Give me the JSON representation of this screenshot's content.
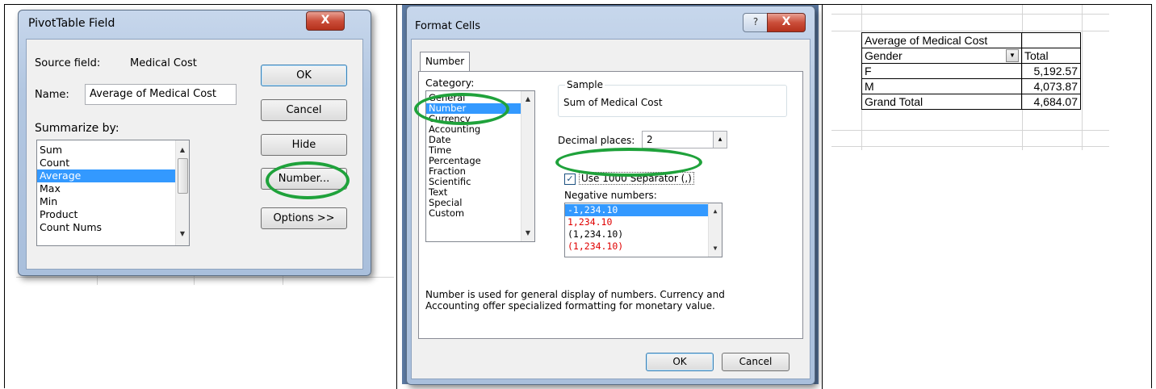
{
  "left_dialog": {
    "title": "PivotTable Field",
    "close_label": "X",
    "source_field_label": "Source field:",
    "source_field_value": "Medical Cost",
    "name_label": "Name:",
    "name_value": "Average of Medical Cost",
    "summarize_label": "Summarize by:",
    "summarize_items": [
      "Sum",
      "Count",
      "Average",
      "Max",
      "Min",
      "Product",
      "Count Nums"
    ],
    "selected_item": "Average",
    "ok_label": "OK",
    "cancel_label": "Cancel",
    "hide_label": "Hide",
    "number_label": "Number...",
    "options_label": "Options >>"
  },
  "format_dialog": {
    "title": "Format Cells",
    "help_label": "?",
    "close_label": "X",
    "tab_label": "Number",
    "category_label": "Category:",
    "categories": [
      "General",
      "Number",
      "Currency",
      "Accounting",
      "Date",
      "Time",
      "Percentage",
      "Fraction",
      "Scientific",
      "Text",
      "Special",
      "Custom"
    ],
    "selected_category": "Number",
    "sample_label": "Sample",
    "sample_value": "Sum of Medical Cost",
    "decimal_label": "Decimal places:",
    "decimal_value": "2",
    "separator_label": "Use 1000 Separator (,)",
    "separator_checked": true,
    "negative_label": "Negative numbers:",
    "negative_items": [
      {
        "text": "-1,234.10",
        "color": "#000000",
        "selected": true
      },
      {
        "text": "1,234.10",
        "color": "#e00000",
        "selected": false
      },
      {
        "text": "(1,234.10)",
        "color": "#000000",
        "selected": false
      },
      {
        "text": "(1,234.10)",
        "color": "#e00000",
        "selected": false
      }
    ],
    "description": "Number is used for general display of numbers.  Currency and Accounting offer specialized formatting for monetary value.",
    "ok_label": "OK",
    "cancel_label": "Cancel"
  },
  "pivot_table": {
    "header": "Average of Medical Cost",
    "row_label": "Gender",
    "col_label": "Total",
    "rows": [
      {
        "label": "F",
        "value": "5,192.57"
      },
      {
        "label": "M",
        "value": "4,073.87"
      },
      {
        "label": "Grand Total",
        "value": "4,684.07"
      }
    ]
  },
  "colors": {
    "highlight_oval": "#1fa23b",
    "selection": "#3399ff"
  }
}
